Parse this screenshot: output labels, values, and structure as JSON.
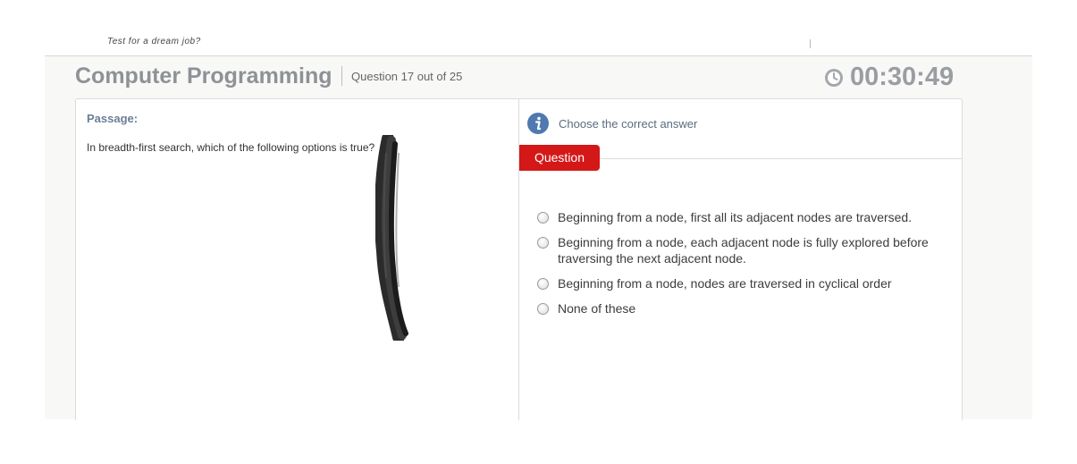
{
  "header": {
    "tagline": "Test for a dream job?"
  },
  "quiz": {
    "title": "Computer Programming",
    "question_counter": "Question 17 out of 25",
    "timer": "00:30:49"
  },
  "passage": {
    "label": "Passage:",
    "text": "In breadth-first search, which of the following options is true?"
  },
  "question_panel": {
    "instruction": "Choose the correct answer",
    "tab_label": "Question",
    "options": [
      "Beginning from a node, first all its adjacent nodes are traversed.",
      "Beginning from a node, each adjacent node is fully explored before traversing the next adjacent node.",
      "Beginning from a node, nodes are traversed in cyclical order",
      "None of these"
    ]
  },
  "colors": {
    "accent_red": "#d41818",
    "title_gray": "#8e9297",
    "label_blue": "#6a7f96"
  },
  "icons": {
    "timer": "clock-icon",
    "instruction": "info-icon"
  }
}
